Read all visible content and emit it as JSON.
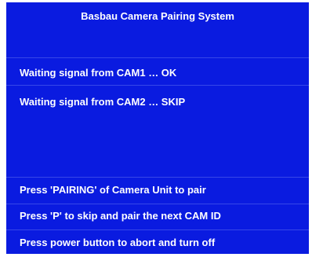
{
  "title": "Basbau Camera Pairing System",
  "status_lines": [
    "Waiting signal from CAM1 … OK",
    "Waiting signal from CAM2 … SKIP"
  ],
  "instructions": [
    "Press 'PAIRING' of Camera Unit to pair",
    "Press 'P' to skip and pair the next CAM ID",
    "Press power button to abort and turn off"
  ],
  "colors": {
    "background": "#0a1be0",
    "text": "#ffffff"
  }
}
